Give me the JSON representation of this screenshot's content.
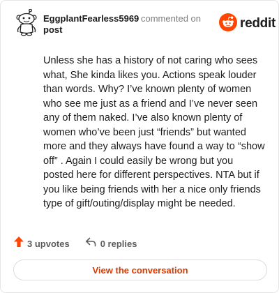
{
  "comment": {
    "author": "EggplantFearless5969",
    "action_text": "commented on",
    "target_link": "post",
    "body": "Unless she has a history of not caring who sees what, She kinda likes you. Actions speak louder than words. Why? I’ve known plenty of women who see me just as a friend and I’ve never seen any of them naked. I’ve also known plenty of women who’ve been just “friends” but wanted more and they always have found a way to “show off” . Again I could easily be wrong but you posted here for different perspectives. NTA but if you like being friends with her a nice only friends type of gift/outing/display might be needed."
  },
  "brand": {
    "name": "reddit",
    "icon": "reddit-snoo-icon",
    "color": "#ff4500"
  },
  "footer": {
    "upvotes_label": "3 upvotes",
    "upvote_icon": "upvote-arrow-icon",
    "replies_label": "0 replies",
    "reply_icon": "reply-arrow-icon"
  },
  "cta": {
    "label": "View the conversation"
  },
  "colors": {
    "accent": "#d93a00",
    "upvote": "#ff4500",
    "muted": "#7c7c7c",
    "text": "#1c1c1c"
  }
}
